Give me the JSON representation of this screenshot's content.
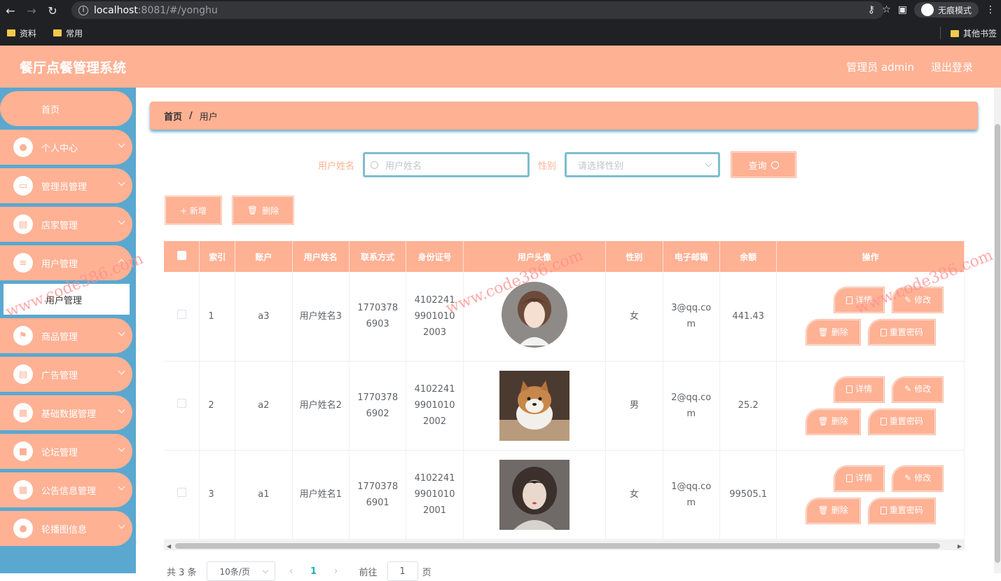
{
  "browser": {
    "url_host": "localhost",
    "url_rest": ":8081/#/yonghu",
    "incognito_label": "无痕模式",
    "bookmarks": [
      "资料",
      "常用"
    ],
    "other_bookmarks": "其他书签"
  },
  "header": {
    "title": "餐厅点餐管理系统",
    "user_label": "管理员 admin",
    "logout": "退出登录",
    "color": "#ffb194"
  },
  "sidebar": {
    "home": "首页",
    "items": [
      {
        "label": "个人中心",
        "icon": "user-icon"
      },
      {
        "label": "管理员管理",
        "icon": "monitor-icon"
      },
      {
        "label": "店家管理",
        "icon": "clipboard-icon"
      },
      {
        "label": "用户管理",
        "icon": "sliders-icon"
      },
      {
        "label": "商品管理",
        "icon": "flag-icon"
      },
      {
        "label": "广告管理",
        "icon": "clipboard-icon"
      },
      {
        "label": "基础数据管理",
        "icon": "grid-icon"
      },
      {
        "label": "论坛管理",
        "icon": "briefcase-icon"
      },
      {
        "label": "公告信息管理",
        "icon": "grid-icon"
      },
      {
        "label": "轮播图信息",
        "icon": "user-icon"
      }
    ],
    "sub_active": "用户管理"
  },
  "breadcrumb": {
    "home": "首页",
    "separator": "/",
    "current": "用户"
  },
  "search": {
    "name_label": "用户姓名",
    "name_placeholder": "用户姓名",
    "gender_label": "性别",
    "gender_placeholder": "请选择性别",
    "query_button": "查询"
  },
  "actions": {
    "add": "+ 新增",
    "delete": "删除"
  },
  "table": {
    "headers": [
      "索引",
      "账户",
      "用户姓名",
      "联系方式",
      "身份证号",
      "用户头像",
      "性别",
      "电子邮箱",
      "余额",
      "操作"
    ],
    "rows": [
      {
        "index": "1",
        "account": "a3",
        "name": "用户姓名3",
        "phone": "17703786903",
        "id_card": "410224199010102003",
        "avatar": "girl-illustration",
        "gender": "女",
        "email": "3@qq.com",
        "balance": "441.43"
      },
      {
        "index": "2",
        "account": "a2",
        "name": "用户姓名2",
        "phone": "17703786902",
        "id_card": "410224199010102002",
        "avatar": "shiba-dog-photo",
        "gender": "男",
        "email": "2@qq.com",
        "balance": "25.2"
      },
      {
        "index": "3",
        "account": "a1",
        "name": "用户姓名1",
        "phone": "17703786901",
        "id_card": "410224199010102001",
        "avatar": "girl-photo",
        "gender": "女",
        "email": "1@qq.com",
        "balance": "99505.1"
      }
    ],
    "ops": {
      "detail": "详情",
      "edit": "修改",
      "delete": "删除",
      "reset": "重置密码"
    }
  },
  "pagination": {
    "total": "共 3 条",
    "page_size": "10条/页",
    "current": "1",
    "goto_label": "前往",
    "goto_value": "1",
    "page_suffix": "页"
  },
  "watermark": "www.code386.com"
}
